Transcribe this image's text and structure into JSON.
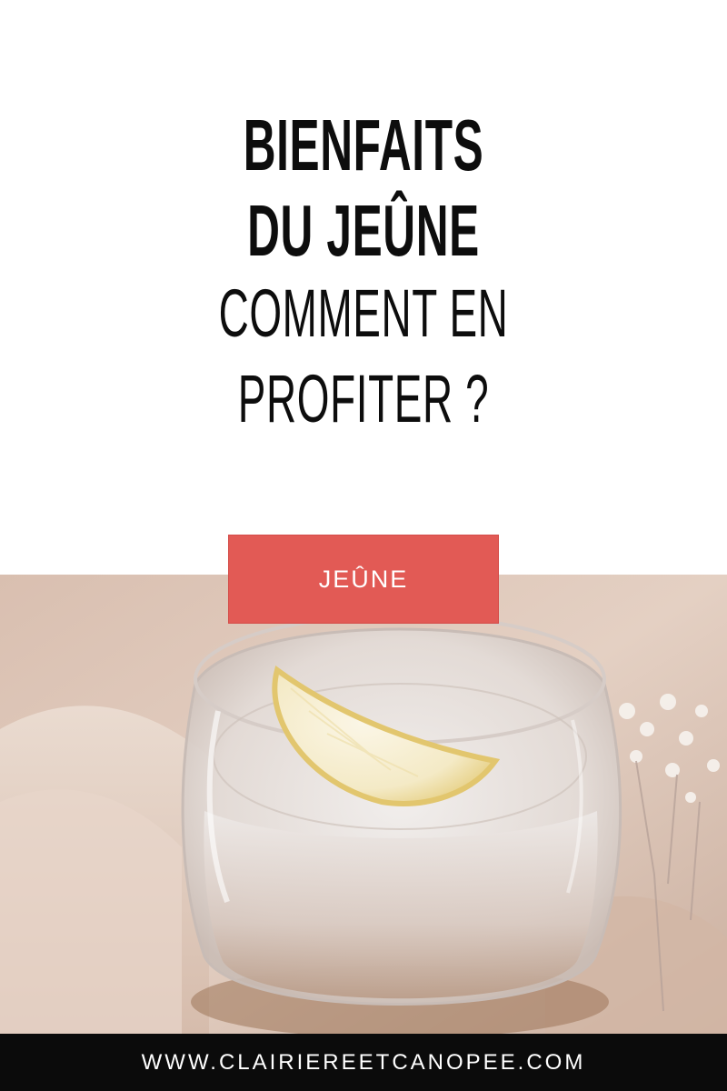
{
  "title": {
    "line1": "BIENFAITS",
    "line2": "DU JEÛNE",
    "line3": "COMMENT EN",
    "line4": "PROFITER ?"
  },
  "category_badge": {
    "label": "JEÛNE",
    "color": "#e25a55"
  },
  "photo": {
    "subject": "glass-of-water-with-lemon-slice"
  },
  "footer": {
    "website": "WWW.CLAIRIEREETCANOPEE.COM"
  }
}
